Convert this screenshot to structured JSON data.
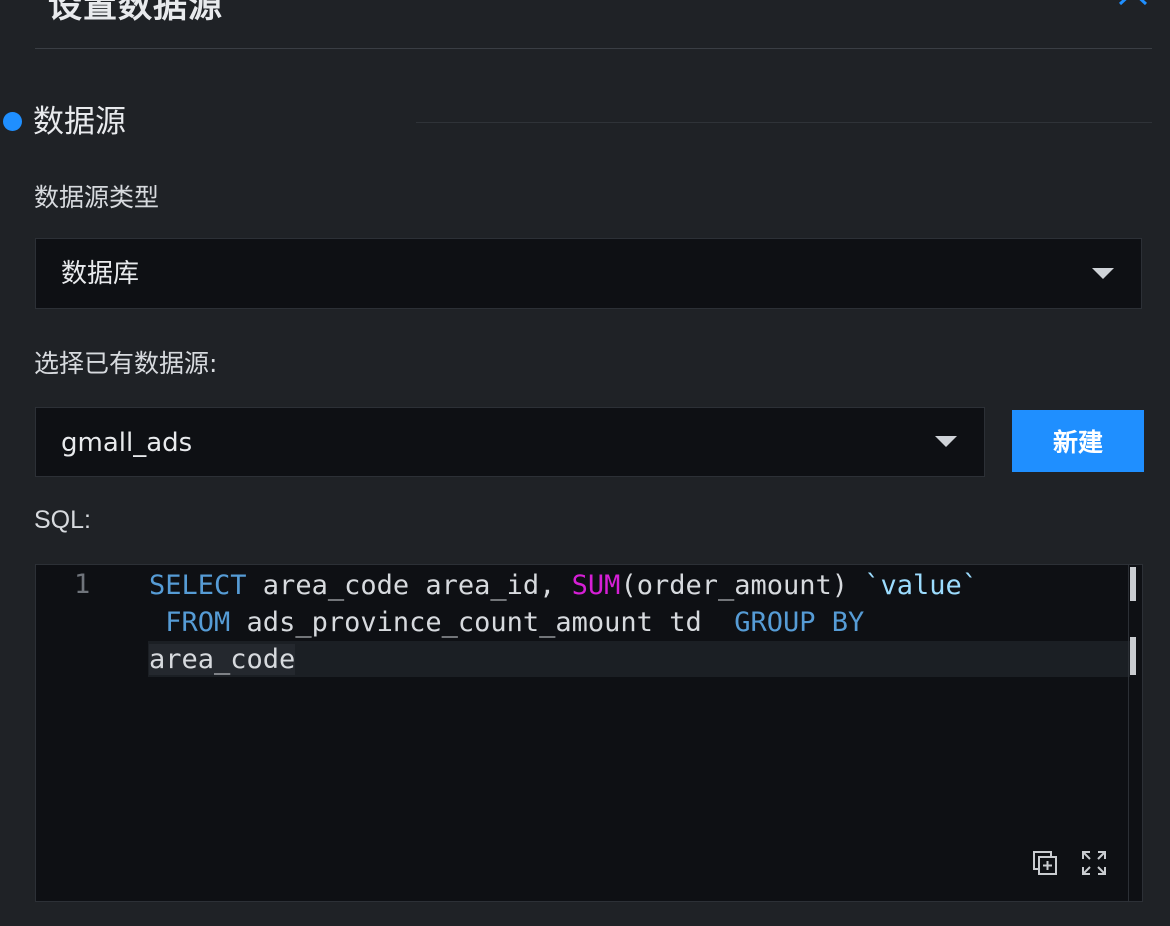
{
  "header": {
    "title": "设置数据源",
    "close_icon": "close-icon"
  },
  "section": {
    "title": "数据源",
    "accent_color": "#1f8fff"
  },
  "datasource_type": {
    "label": "数据源类型",
    "value": "数据库"
  },
  "existing_source": {
    "label": "选择已有数据源:",
    "value": "gmall_ads",
    "new_button_label": "新建"
  },
  "sql": {
    "label": "SQL:",
    "line_number": "1",
    "tokens": {
      "select": "SELECT",
      "area_code_alias": " area_code area_id, ",
      "sum": "SUM",
      "sum_arg": "(order_amount) ",
      "value_alias": "`value`",
      "indent": " ",
      "from": "FROM",
      "table": " ads_province_count_amount td  ",
      "group_by": "GROUP BY",
      "tail": "area_code"
    },
    "tools": {
      "copy_icon": "copy-icon",
      "fullscreen_icon": "fullscreen-icon"
    }
  }
}
